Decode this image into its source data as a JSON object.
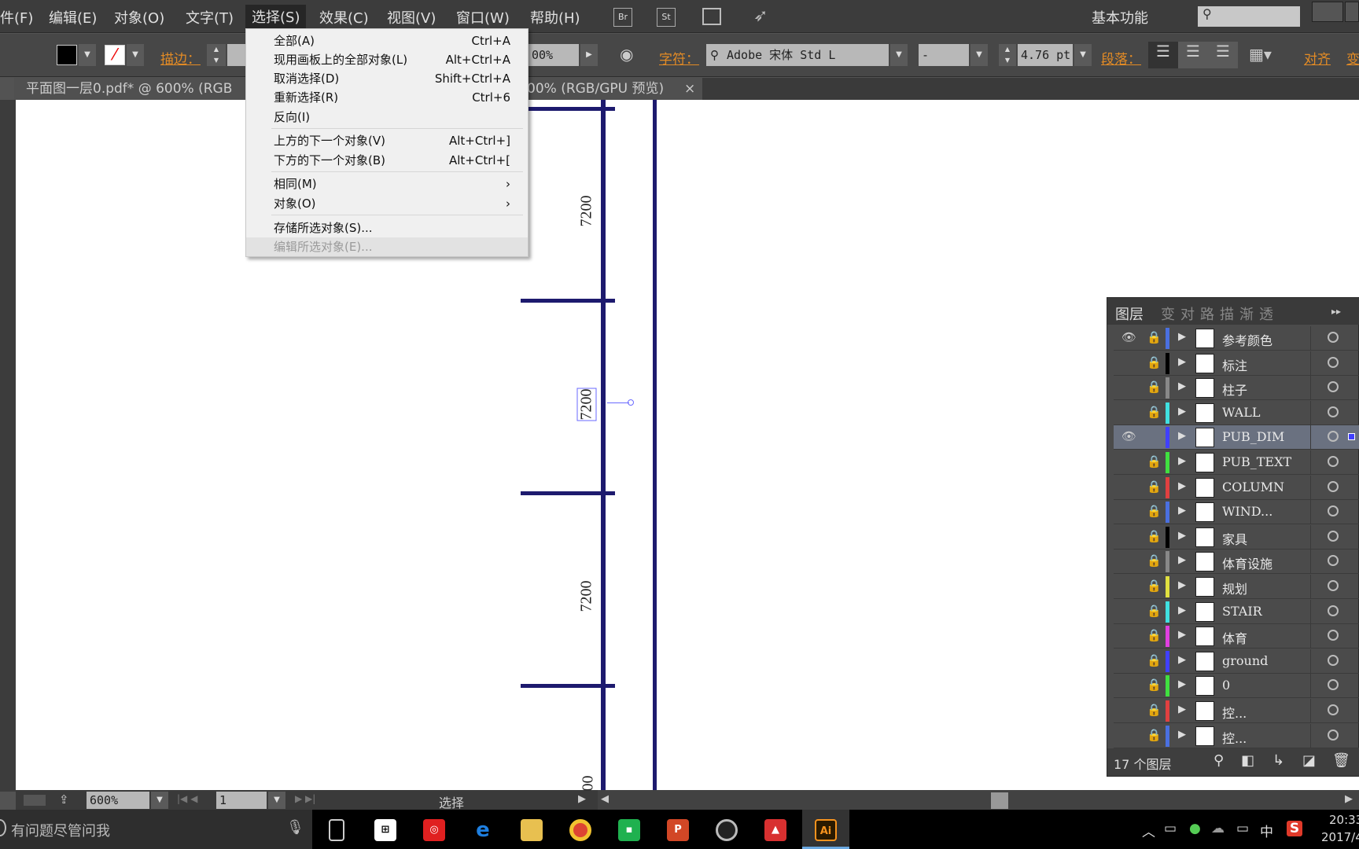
{
  "menubar": {
    "items": [
      "件(F)",
      "编辑(E)",
      "对象(O)",
      "文字(T)",
      "选择(S)",
      "效果(C)",
      "视图(V)",
      "窗口(W)",
      "帮助(H)"
    ],
    "active": "选择(S)",
    "bridge": "Br",
    "stock": "St",
    "workspace": "基本功能"
  },
  "control": {
    "stroke_label": "描边：",
    "opacity_value": "00%",
    "char_label": "字符：",
    "font_name": "Adobe 宋体 Std L",
    "font_style": "-",
    "font_size": "4.76 pt",
    "para_label": "段落：",
    "align_label": "对齐",
    "transform_label": "变"
  },
  "tab": {
    "title": "平面图一层0.pdf* @ 600% (RGB",
    "title_tail": "00% (RGB/GPU 预览)",
    "close": "×"
  },
  "select_menu": {
    "items": [
      {
        "label": "全部(A)",
        "shortcut": "Ctrl+A"
      },
      {
        "label": "现用画板上的全部对象(L)",
        "shortcut": "Alt+Ctrl+A"
      },
      {
        "label": "取消选择(D)",
        "shortcut": "Shift+Ctrl+A"
      },
      {
        "label": "重新选择(R)",
        "shortcut": "Ctrl+6"
      },
      {
        "label": "反向(I)",
        "shortcut": ""
      },
      {
        "label": "上方的下一个对象(V)",
        "shortcut": "Alt+Ctrl+]"
      },
      {
        "label": "下方的下一个对象(B)",
        "shortcut": "Alt+Ctrl+["
      },
      {
        "label": "相同(M)",
        "shortcut": "›"
      },
      {
        "label": "对象(O)",
        "shortcut": "›"
      },
      {
        "label": "存储所选对象(S)...",
        "shortcut": ""
      },
      {
        "label": "编辑所选对象(E)...",
        "shortcut": "",
        "disabled": true
      }
    ]
  },
  "canvas": {
    "dim_labels": [
      "7200",
      "7200",
      "7200",
      "00"
    ],
    "line_color": "#1d1a6e"
  },
  "layers": {
    "tabs": [
      "图层",
      "变",
      "对",
      "路",
      "描",
      "渐",
      "透"
    ],
    "count_label": "17 个图层",
    "rows": [
      {
        "name": "参考颜色",
        "color": "#4a70e0",
        "visible": true,
        "locked": true
      },
      {
        "name": "标注",
        "color": "#000000",
        "visible": false,
        "locked": true
      },
      {
        "name": "柱子",
        "color": "#888888",
        "visible": false,
        "locked": true
      },
      {
        "name": "WALL",
        "color": "#40e0e0",
        "visible": false,
        "locked": true
      },
      {
        "name": "PUB_DIM",
        "color": "#4040ff",
        "visible": true,
        "locked": false,
        "selected": true
      },
      {
        "name": "PUB_TEXT",
        "color": "#40e040",
        "visible": false,
        "locked": true
      },
      {
        "name": "COLUMN",
        "color": "#e04040",
        "visible": false,
        "locked": true
      },
      {
        "name": "WIND...",
        "color": "#4a70e0",
        "visible": false,
        "locked": true
      },
      {
        "name": "家具",
        "color": "#000000",
        "visible": false,
        "locked": true
      },
      {
        "name": "体育设施",
        "color": "#888888",
        "visible": false,
        "locked": true
      },
      {
        "name": "规划",
        "color": "#e0e040",
        "visible": false,
        "locked": true
      },
      {
        "name": "STAIR",
        "color": "#40e0e0",
        "visible": false,
        "locked": true
      },
      {
        "name": "体育",
        "color": "#e040e0",
        "visible": false,
        "locked": true
      },
      {
        "name": "ground",
        "color": "#4040ff",
        "visible": false,
        "locked": true
      },
      {
        "name": "0",
        "color": "#40e040",
        "visible": false,
        "locked": true
      },
      {
        "name": "控...",
        "color": "#e04040",
        "visible": false,
        "locked": true
      },
      {
        "name": "控...",
        "color": "#4a70e0",
        "visible": false,
        "locked": true
      }
    ]
  },
  "status": {
    "zoom": "600%",
    "page": "1",
    "tool": "选择"
  },
  "taskbar": {
    "search_placeholder": "有问题尽管问我",
    "ime": "中",
    "time": "20:33",
    "date": "2017/4",
    "apps": [
      "task-view",
      "store",
      "netease-music",
      "edge",
      "file-explorer",
      "chrome",
      "green-app",
      "powerpoint",
      "obs",
      "autocad",
      "illustrator"
    ]
  }
}
